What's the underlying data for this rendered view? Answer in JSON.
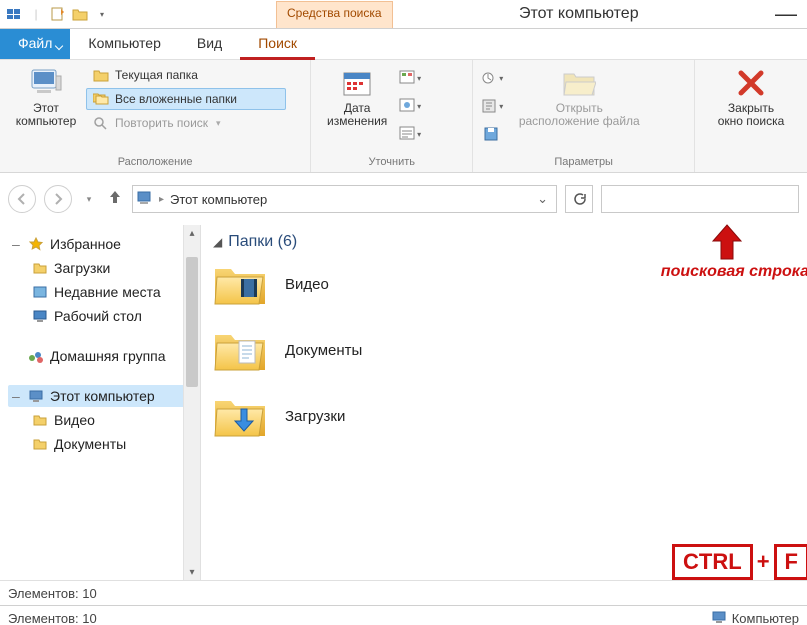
{
  "window": {
    "title": "Этот компьютер",
    "contextual_tab": "Средства поиска"
  },
  "tabs": {
    "file": "Файл",
    "computer": "Компьютер",
    "view": "Вид",
    "search": "Поиск"
  },
  "ribbon": {
    "location": {
      "this_pc": "Этот\nкомпьютер",
      "current_folder": "Текущая папка",
      "all_subfolders": "Все вложенные папки",
      "search_again": "Повторить поиск",
      "group_label": "Расположение"
    },
    "refine": {
      "date_modified": "Дата\nизменения",
      "group_label": "Уточнить"
    },
    "options": {
      "open_location": "Открыть\nрасположение файла",
      "group_label": "Параметры"
    },
    "close": {
      "close_search": "Закрыть\nокно поиска"
    }
  },
  "breadcrumb": {
    "path": "Этот компьютер"
  },
  "sidebar": {
    "favorites": "Избранное",
    "downloads": "Загрузки",
    "recent": "Недавние места",
    "desktop": "Рабочий стол",
    "homegroup": "Домашняя группа",
    "this_pc": "Этот компьютер",
    "videos": "Видео",
    "documents": "Документы"
  },
  "content": {
    "section": "Папки (6)",
    "items": {
      "videos": "Видео",
      "documents": "Документы",
      "downloads": "Загрузки"
    }
  },
  "annot": {
    "search_string": "поисковая строка",
    "ctrl": "CTRL",
    "plus": "+",
    "f": "F"
  },
  "status": {
    "items1": "Элементов: 10",
    "items2": "Элементов: 10",
    "computer": "Компьютер"
  }
}
